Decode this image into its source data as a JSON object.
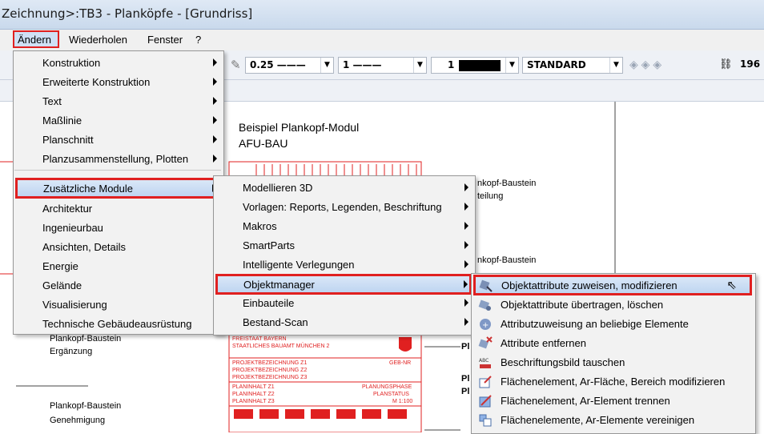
{
  "window": {
    "title": "Zeichnung>:TB3 - Planköpfe - [Grundriss]"
  },
  "menubar": {
    "items": [
      {
        "label": "Ändern",
        "underline": "Ä"
      },
      {
        "label": "Wiederholen",
        "underline": "W"
      },
      {
        "label": "Fenster",
        "underline": "F"
      },
      {
        "label": "?",
        "underline": "?"
      }
    ]
  },
  "toolbar": {
    "pen_value": "0.25 ———",
    "line_value": "1 ———",
    "color_value": "1",
    "layer_value": "STANDARD",
    "right_number": "196"
  },
  "menu1": {
    "items": [
      {
        "label": "Konstruktion"
      },
      {
        "label": "Erweiterte Konstruktion"
      },
      {
        "label": "Text"
      },
      {
        "label": "Maßlinie"
      },
      {
        "label": "Planschnitt"
      },
      {
        "label": "Planzusammenstellung, Plotten"
      },
      {
        "label": "Zusätzliche Module"
      },
      {
        "label": "Architektur"
      },
      {
        "label": "Ingenieurbau"
      },
      {
        "label": "Ansichten, Details"
      },
      {
        "label": "Energie"
      },
      {
        "label": "Gelände"
      },
      {
        "label": "Visualisierung"
      },
      {
        "label": "Technische Gebäudeausrüstung"
      }
    ]
  },
  "menu2": {
    "items": [
      {
        "label": "Modellieren 3D"
      },
      {
        "label": "Vorlagen: Reports, Legenden, Beschriftung"
      },
      {
        "label": "Makros"
      },
      {
        "label": "SmartParts"
      },
      {
        "label": "Intelligente Verlegungen"
      },
      {
        "label": "Objektmanager"
      },
      {
        "label": "Einbauteile"
      },
      {
        "label": "Bestand-Scan"
      }
    ]
  },
  "menu3": {
    "items": [
      {
        "label": "Objektattribute zuweisen, modifizieren",
        "icon": "attribute-assign-icon"
      },
      {
        "label": "Objektattribute übertragen, löschen",
        "icon": "attribute-transfer-icon"
      },
      {
        "label": "Attributzuweisung an beliebige Elemente",
        "icon": "attribute-any-icon"
      },
      {
        "label": "Attribute entfernen",
        "icon": "attribute-remove-icon"
      },
      {
        "label": "Beschriftungsbild tauschen",
        "icon": "label-swap-icon"
      },
      {
        "label": "Flächenelement, Ar-Fläche, Bereich modifizieren",
        "icon": "area-modify-icon"
      },
      {
        "label": "Flächenelement, Ar-Element trennen",
        "icon": "area-split-icon"
      },
      {
        "label": "Flächenelemente, Ar-Elemente vereinigen",
        "icon": "area-merge-icon"
      }
    ]
  },
  "drawing": {
    "heading1": "Beispiel Plankopf-Modul",
    "heading2": "AFU-BAU",
    "label_a1": "nkopf-Baustein",
    "label_a2": "teilung",
    "label_b1": "nkopf-Baustein",
    "label_c1": "Plankopf-Baustein",
    "label_c2": "Ergänzung",
    "label_d1": "Plankopf-Baustein",
    "label_d2": "Genehmigung",
    "stamp_line1": "FREISTAAT BAYERN",
    "stamp_line2": "STAATLICHES BAUAMT MÜNCHEN 2",
    "proj1": "PROJEKTBEZEICHNUNG Z1",
    "proj2": "PROJEKTBEZEICHNUNG Z2",
    "proj3": "PROJEKTBEZEICHNUNG Z3",
    "proj_right": "GEB-NR",
    "plan1": "PLANINHALT Z1",
    "plan2": "PLANINHALT Z2",
    "plan3": "PLANINHALT Z3",
    "phase": "PLANUNGSPHASE",
    "status": "PLANSTATUS",
    "scale": "M 1:100",
    "cut1": "Pl",
    "cut2": "Pl",
    "cut3": "Pl"
  },
  "colors": {
    "highlight_border": "#e02020",
    "drawing_red": "#e02020",
    "menu_bg": "#f2f2f2"
  }
}
